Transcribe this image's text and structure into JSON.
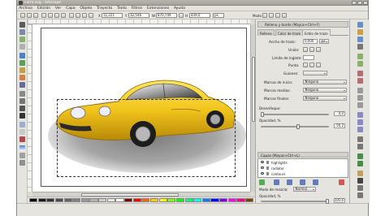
{
  "window": {
    "title": "carro.svg - Inkscape"
  },
  "menu": [
    "Archivo",
    "Edición",
    "Ver",
    "Capa",
    "Objeto",
    "Trayecto",
    "Texto",
    "Filtros",
    "Extensiones",
    "Ayuda"
  ],
  "toolbar": {
    "x_label": "X",
    "x_value": "11,221",
    "y_label": "Y",
    "y_value": "12,546",
    "w_label": "W",
    "w_value": "870,749",
    "h_label": "H",
    "h_value": "439,0",
    "units_value": "px",
    "mode_label": "Modo"
  },
  "dock": {
    "title": "Relleno y borde (Mayús+Ctrl+F)",
    "tabs": [
      "Relleno",
      "Color de trazo",
      "Estilo de trazo"
    ],
    "stroke_width_label": "Ancho de trazo:",
    "stroke_width_value": "0,000",
    "stroke_unit": "px",
    "join_label": "Unión:",
    "miter_label": "Límite de inglete:",
    "cap_label": "Punta:",
    "dashes_label": "Guiones:",
    "start_markers_label": "Marcas de inicio:",
    "start_markers_value": "Ninguno",
    "mid_markers_label": "Marcas medias:",
    "mid_markers_value": "Ninguno",
    "end_markers_label": "Marcas finales:",
    "end_markers_value": "Ninguno",
    "blur_label": "Desenfoque:",
    "blur_value": "0,0",
    "opacity_label": "Opacidad, %",
    "opacity_value": "56,2"
  },
  "layers": {
    "title": "Capas (Mayús+Ctrl+L)",
    "items": [
      "highlights",
      "radiator",
      "contours"
    ],
    "blend_label": "Modo de mezcla:",
    "blend_value": "Normal",
    "opacity_label": "Opacidad, %",
    "opacity_value": "100,0"
  },
  "colors": {
    "car_body": "#f2c41b",
    "shadow": "#8e8e8e",
    "palette": [
      "#000000",
      "#1a1a1a",
      "#333333",
      "#4d4d4d",
      "#666666",
      "#808080",
      "#999999",
      "#b3b3b3",
      "#cccccc",
      "#e6e6e6",
      "#ffffff",
      "#800000",
      "#ff0000",
      "#ff6600",
      "#ffcc00",
      "#ffff00",
      "#80ff00",
      "#00ff00",
      "#00ff80",
      "#00ffff",
      "#0080ff",
      "#0000ff",
      "#8000ff",
      "#ff00ff",
      "#ff0080",
      "#804000"
    ]
  }
}
